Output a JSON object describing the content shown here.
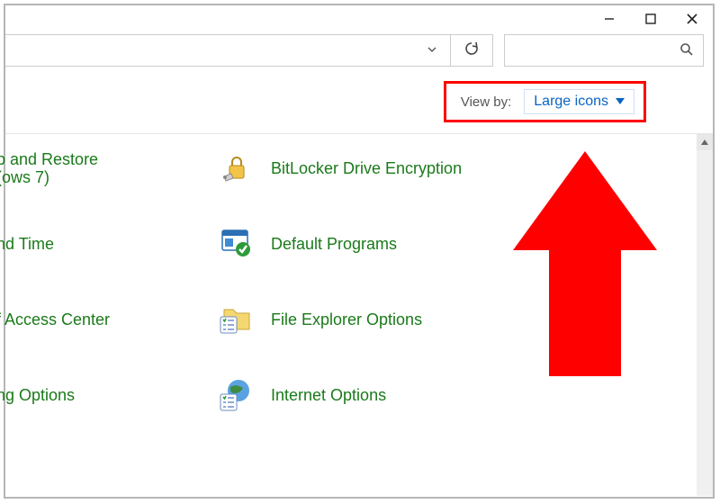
{
  "window": {
    "minimize_icon": "minimize",
    "maximize_icon": "maximize",
    "close_icon": "close"
  },
  "toolbar": {
    "address_value": "",
    "address_dropdown_icon": "chevron-down",
    "refresh_icon": "refresh",
    "search_placeholder": "",
    "search_icon": "search"
  },
  "viewby": {
    "label": "View by:",
    "value": "Large icons",
    "dropdown_icon": "caret-down"
  },
  "items_left": [
    {
      "label": "p and Restore\n(ows 7)",
      "icon": "backup-restore"
    },
    {
      "label": "nd Time",
      "icon": "date-time"
    },
    {
      "label": "f Access Center",
      "icon": "ease-of-access"
    },
    {
      "label": "ng Options",
      "icon": "indexing"
    }
  ],
  "items_right": [
    {
      "label": "BitLocker Drive Encryption",
      "icon": "bitlocker"
    },
    {
      "label": "Default Programs",
      "icon": "default-programs"
    },
    {
      "label": "File Explorer Options",
      "icon": "file-explorer-options"
    },
    {
      "label": "Internet Options",
      "icon": "internet-options"
    }
  ],
  "annotation": {
    "arrow": "red-up-arrow"
  }
}
